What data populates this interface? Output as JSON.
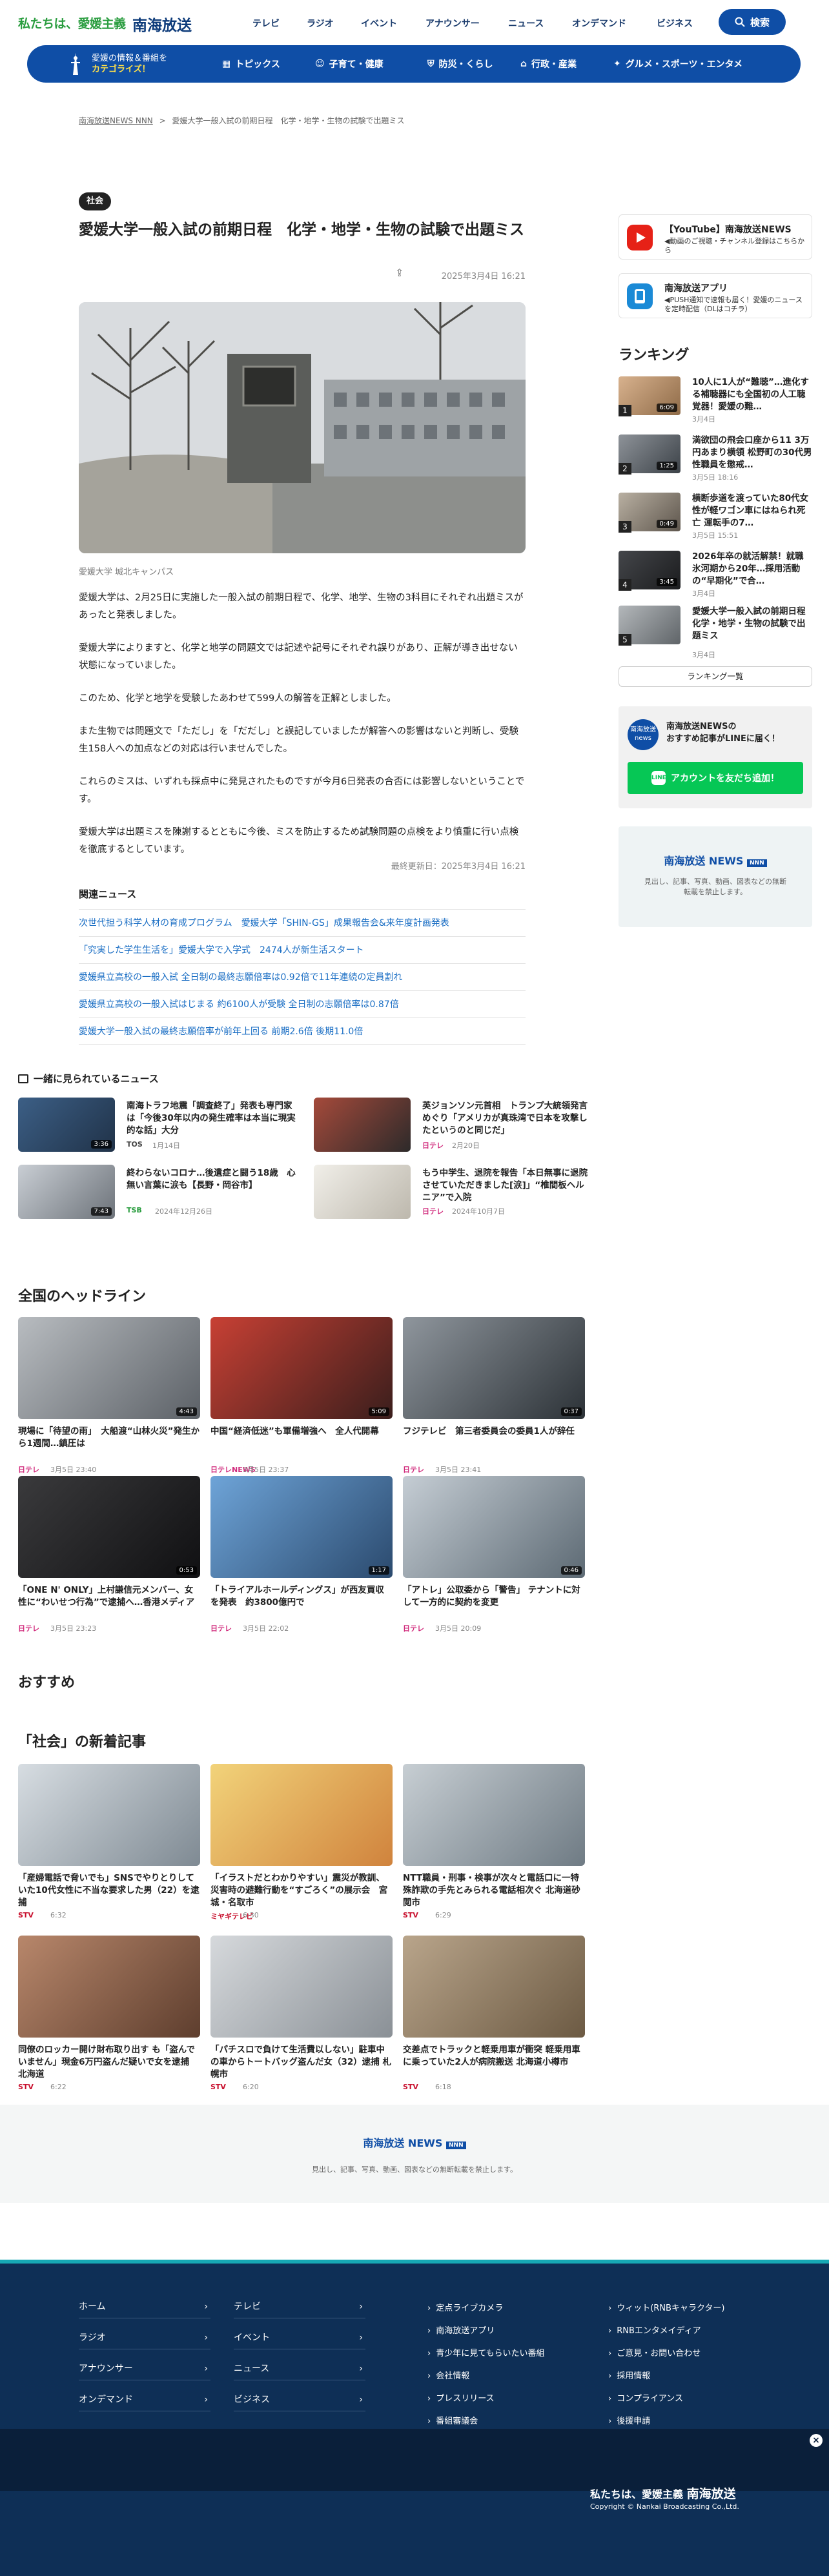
{
  "header": {
    "tagline": "私たちは、愛媛主義",
    "brand": "南海放送",
    "nav": [
      "テレビ",
      "ラジオ",
      "イベント",
      "アナウンサー",
      "ニュース",
      "オンデマンド",
      "ビジネス"
    ],
    "search_label": "検索"
  },
  "category_bar": {
    "promo_line1": "愛媛の情報＆番組を",
    "promo_line2": "カテゴライズ！",
    "items": [
      "トピックス",
      "子育て・健康",
      "防災・くらし",
      "行政・産業",
      "グルメ・スポーツ・エンタメ"
    ]
  },
  "breadcrumb": {
    "home": "南海放送NEWS NNN",
    "sep": ">",
    "current": "愛媛大学一般入試の前期日程　化学・地学・生物の試験で出題ミス"
  },
  "article": {
    "tag": "社会",
    "title": "愛媛大学一般入試の前期日程　化学・地学・生物の試験で出題ミス",
    "date": "2025年3月4日 16:21",
    "caption": "愛媛大学 城北キャンパス",
    "paragraphs": [
      "愛媛大学は、2月25日に実施した一般入試の前期日程で、化学、地学、生物の3科目にそれぞれ出題ミスがあったと発表しました。",
      "愛媛大学によりますと、化学と地学の問題文では記述や記号にそれぞれ誤りがあり、正解が導き出せない状態になっていました。",
      "このため、化学と地学を受験したあわせて599人の解答を正解としました。",
      "また生物では問題文で「ただし」を「だだし」と誤記していましたが解答への影響はないと判断し、受験生158人への加点などの対応は行いませんでした。",
      "これらのミスは、いずれも採点中に発見されたものですが今月6日発表の合否には影響しないということです。",
      "愛媛大学は出題ミスを陳謝するとともに今後、ミスを防止するため試験問題の点検をより慎重に行い点検を徹底するとしています。"
    ],
    "updated": "最終更新日：2025年3月4日 16:21",
    "related_heading": "関連ニュース",
    "related": [
      "次世代担う科学人材の育成プログラム　愛媛大学「SHIN-GS」成果報告会&来年度計画発表",
      "「究実した学生生活を」愛媛大学で入学式　2474人が新生活スタート",
      "愛媛県立高校の一般入試 全日制の最終志願倍率は0.92倍で11年連続の定員割れ",
      "愛媛県立高校の一般入試はじまる 約6100人が受験 全日制の志願倍率は0.87倍",
      "愛媛大学一般入試の最終志願倍率が前年上回る 前期2.6倍 後期11.0倍"
    ]
  },
  "sidebar": {
    "youtube_title": "【YouTube】南海放送NEWS",
    "youtube_sub": "◀動画のご視聴・チャンネル登録はこちらから",
    "app_title": "南海放送アプリ",
    "app_sub": "◀PUSH通知で速報も届く！愛媛のニュースを定時配信（DLはコチラ）",
    "ranking_heading": "ランキング",
    "ranking": [
      {
        "n": "1",
        "title": "10人に1人が“難聴”…進化する補聴器にも全国初の人工聴覚器！愛媛の難…",
        "date": "3月4日",
        "dur": "6:09"
      },
      {
        "n": "2",
        "title": "満欲団の飛会口座から11 3万円あまり横領 松野町の30代男性職員を懲戒…",
        "date": "3月5日 18:16",
        "dur": "1:25"
      },
      {
        "n": "3",
        "title": "横断歩道を渡っていた80代女性が軽ワゴン車にはねられ死亡 運転手の7…",
        "date": "3月5日 15:51",
        "dur": "0:49"
      },
      {
        "n": "4",
        "title": "2026年卒の就活解禁！就職氷河期から20年…採用活動の“早期化”で合…",
        "date": "3月4日",
        "dur": "3:45"
      },
      {
        "n": "5",
        "title": "愛媛大学一般入試の前期日程　化学・地学・生物の試験で出題ミス",
        "date": "3月4日",
        "dur": ""
      }
    ],
    "ranking_more": "ランキング一覧",
    "line_title": "南海放送NEWSの\nおすすめ記事がLINEに届く！",
    "line_icon": "南海放送 news",
    "line_button": "アカウントを友だち追加！",
    "nnb_logo": "南海放送 NEWS",
    "nnb_badge": "NNN",
    "nnb_note": "見出し、記事、写真、動画、図表などの無断転載を禁止します。"
  },
  "also_viewed": {
    "heading": "一緒に見られているニュース",
    "items": [
      {
        "title": "南海トラフ地震「調査終了」発表も専門家は「今後30年以内の発生確率は本当に現実的な話」大分",
        "src": "TOS",
        "date": "1月14日",
        "dur": "3:36"
      },
      {
        "title": "英ジョンソン元首相　トランプ大統領発言めぐり「アメリカが真珠湾で日本を攻撃したというのと同じだ」",
        "src": "日テレ",
        "date": "2月20日",
        "dur": ""
      },
      {
        "title": "終わらないコロナ…後遺症と闘う18歳　心無い言葉に涙も【長野・岡谷市】",
        "src": "TSB",
        "date": "2024年12月26日",
        "dur": "7:43"
      },
      {
        "title": "もう中学生、退院を報告「本日無事に退院させていただきました[涙]」“椎間板ヘルニア”で入院",
        "src": "日テレ",
        "date": "2024年10月7日",
        "dur": ""
      }
    ]
  },
  "headlines": {
    "heading": "全国のヘッドライン",
    "items": [
      {
        "title": "現場に「待望の雨」　大船渡“山林火災”発生から1週間…鎮圧は",
        "src": "日テレ",
        "date": "3月5日 23:40",
        "dur": "4:43"
      },
      {
        "title": "中国“経済低迷”も軍備増強へ　全人代開幕",
        "src": "日テレNEWS",
        "date": "3月5日 23:37",
        "dur": "5:09"
      },
      {
        "title": "フジテレビ　第三者委員会の委員1人が辞任",
        "src": "日テレ",
        "date": "3月5日 23:41",
        "dur": "0:37"
      },
      {
        "title": "「ONE N' ONLY」上村謙信元メンバー、女性に“わいせつ行為”で逮捕へ…香港メディア",
        "src": "日テレ",
        "date": "3月5日 23:23",
        "dur": "0:53"
      },
      {
        "title": "「トライアルホールディングス」が西友買収を発表　約3800億円で",
        "src": "日テレ",
        "date": "3月5日 22:02",
        "dur": "1:17"
      },
      {
        "title": "「アトレ」公取委から「警告」 テナントに対して一方的に契約を変更",
        "src": "日テレ",
        "date": "3月5日 20:09",
        "dur": "0:46"
      }
    ]
  },
  "recommend": {
    "heading": "おすすめ"
  },
  "social": {
    "heading": "「社会」の新着記事",
    "items": [
      {
        "title": "「産婦電話で脅いでも」SNSでやりとりしていた10代女性に不当な要求した男（22）を逮捕",
        "src": "STV",
        "date": "6:32"
      },
      {
        "title": "「イラストだとわかりやすい」震災が教訓、災害時の避難行動を“すごろく”の展示会　宮城・名取市",
        "src": "ミヤギテレビ",
        "date": "6:30"
      },
      {
        "title": "NTT職員・刑事・検事が次々と電話口に一特殊詐欺の手先とみられる電話相次ぐ 北海道砂閲市",
        "src": "STV",
        "date": "6:29"
      },
      {
        "title": "同僚のロッカー開け財布取り出す も「盗んでいません」現金6万円盗んだ疑いで女を逮捕 北海道",
        "src": "STV",
        "date": "6:22"
      },
      {
        "title": "「パチスロで負けて生活費以しない」駐車中の車からトートバッグ盗んだ女（32）逮捕 札幌市",
        "src": "STV",
        "date": "6:20"
      },
      {
        "title": "交差点でトラックと軽乗用車が衝突 軽乗用車に乗っていた2人が病院搬送 北海道小樽市",
        "src": "STV",
        "date": "6:18"
      }
    ]
  },
  "footer": {
    "logo": "南海放送 NEWS",
    "badge": "NNN",
    "note": "見出し、記事、写真、動画、図表などの無断転載を禁止します。",
    "left_links": [
      "ホーム",
      "テレビ",
      "ラジオ",
      "イベント",
      "アナウンサー",
      "ニュース",
      "オンデマンド",
      "ビジネス"
    ],
    "right_col1": [
      "定点ライブカメラ",
      "南海放送アプリ",
      "青少年に見てもらいたい番組",
      "会社情報",
      "プレスリリース",
      "番組審議会"
    ],
    "right_col2": [
      "ウィット(RNBキャラクター)",
      "RNBエンタメイディア",
      "ご意見・お問い合わせ",
      "採用情報",
      "コンプライアンス",
      "後援申請"
    ],
    "tagline": "私たちは、愛媛主義",
    "brand": "南海放送",
    "copyright": "Copyright © Nankai Broadcasting Co.,Ltd.",
    "close": "×"
  },
  "colors": {
    "accent": "#0f4ea6",
    "brand_green": "#2a9d3f",
    "link": "#1a6ec4",
    "footer": "#0e2f56",
    "line": "#06c755"
  }
}
